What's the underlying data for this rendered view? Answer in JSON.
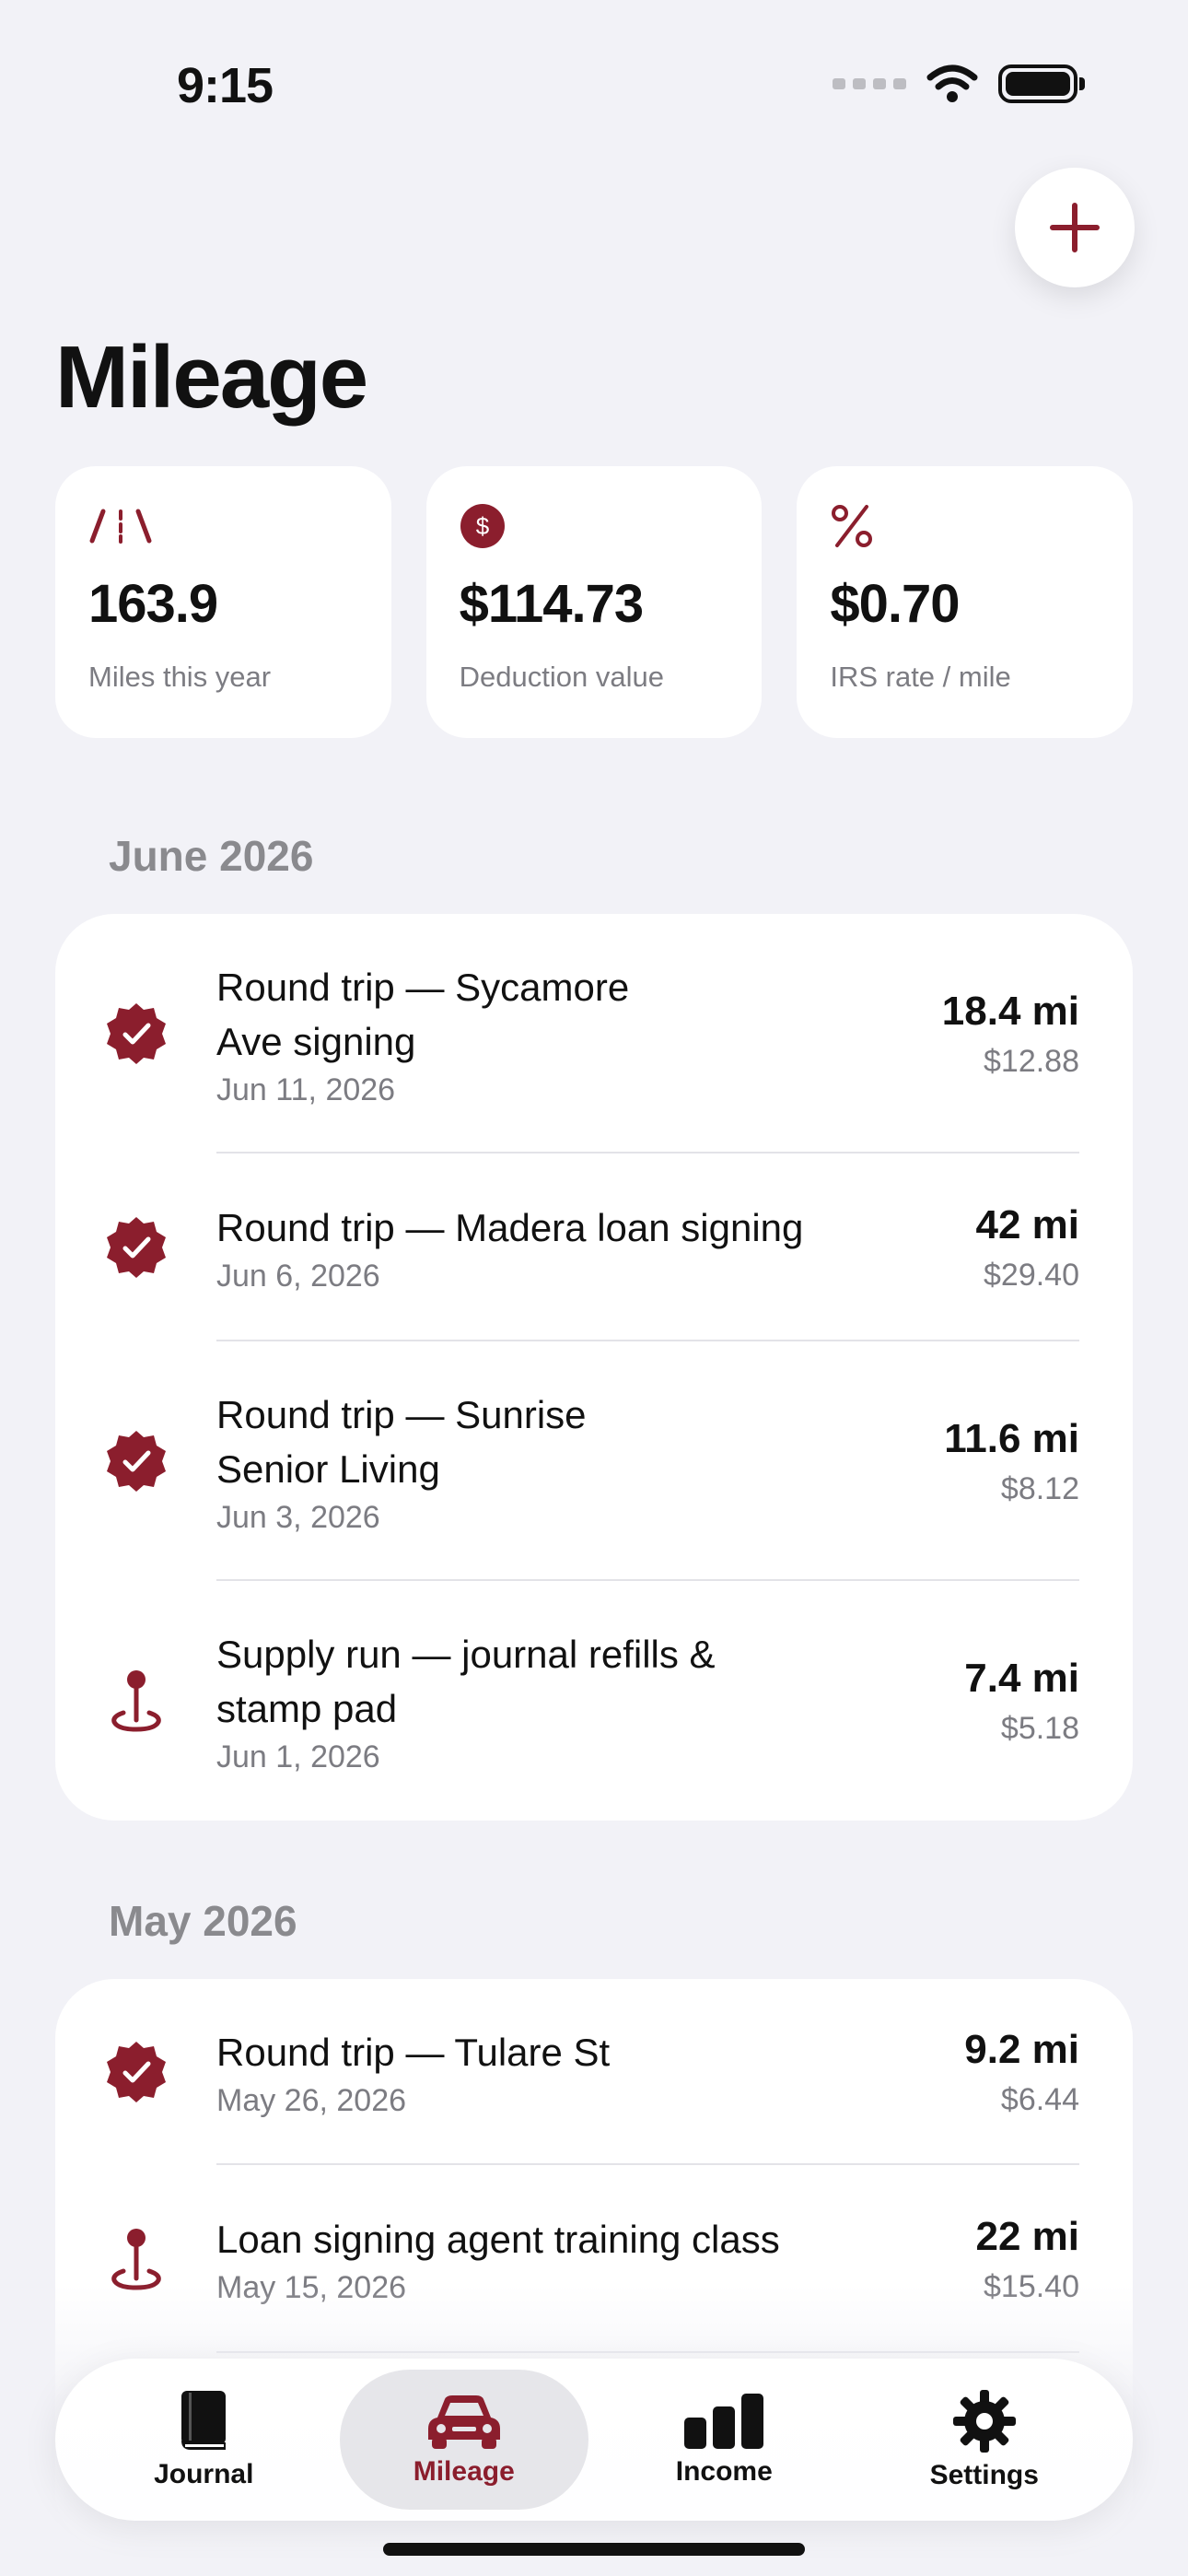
{
  "status": {
    "time": "9:15"
  },
  "page": {
    "title": "Mileage"
  },
  "stats": [
    {
      "value": "163.9",
      "label": "Miles this year",
      "icon": "road-icon"
    },
    {
      "value": "$114.73",
      "label": "Deduction value",
      "icon": "dollar-circle-icon"
    },
    {
      "value": "$0.70",
      "label": "IRS rate / mile",
      "icon": "percent-icon"
    }
  ],
  "sections": [
    {
      "header": "June 2026",
      "trips": [
        {
          "title_lines": [
            "Round trip — Sycamore",
            "Ave signing"
          ],
          "date": "Jun 11, 2026",
          "miles": "18.4 mi",
          "amount": "$12.88",
          "icon": "verified-badge-icon"
        },
        {
          "title_lines": [
            "Round trip — Madera loan signing"
          ],
          "date": "Jun 6, 2026",
          "miles": "42 mi",
          "amount": "$29.40",
          "icon": "verified-badge-icon"
        },
        {
          "title_lines": [
            "Round trip — Sunrise",
            "Senior Living"
          ],
          "date": "Jun 3, 2026",
          "miles": "11.6 mi",
          "amount": "$8.12",
          "icon": "verified-badge-icon"
        },
        {
          "title_lines": [
            "Supply run — journal refills &",
            "stamp pad"
          ],
          "date": "Jun 1, 2026",
          "miles": "7.4 mi",
          "amount": "$5.18",
          "icon": "map-pin-icon"
        }
      ]
    },
    {
      "header": "May 2026",
      "trips": [
        {
          "title_lines": [
            "Round trip — Tulare St"
          ],
          "date": "May 26, 2026",
          "miles": "9.2 mi",
          "amount": "$6.44",
          "icon": "verified-badge-icon"
        },
        {
          "title_lines": [
            "Loan signing agent training class"
          ],
          "date": "May 15, 2026",
          "miles": "22 mi",
          "amount": "$15.40",
          "icon": "map-pin-icon"
        }
      ]
    }
  ],
  "tabbar": {
    "tabs": [
      {
        "label": "Journal",
        "icon": "book-icon"
      },
      {
        "label": "Mileage",
        "icon": "car-icon",
        "active": true
      },
      {
        "label": "Income",
        "icon": "bar-chart-icon"
      },
      {
        "label": "Settings",
        "icon": "gear-icon"
      }
    ]
  },
  "colors": {
    "accent": "#8B1E2D",
    "background": "#F2F2F7",
    "secondary_text": "#7C7C82"
  }
}
